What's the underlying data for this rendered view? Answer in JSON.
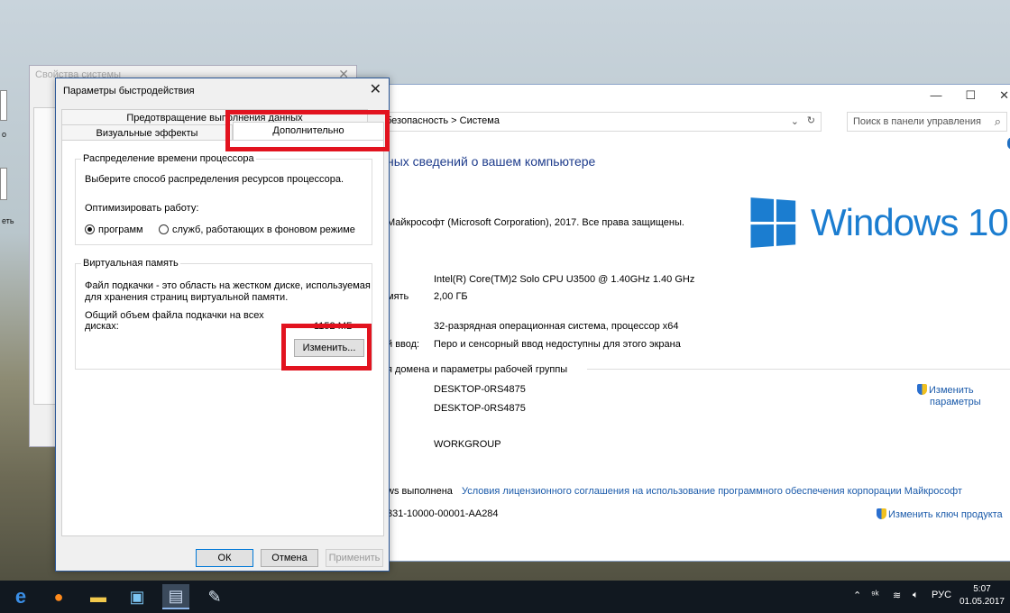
{
  "desktop": {
    "labels": [
      "о",
      "еть"
    ]
  },
  "system_window": {
    "address": "безопасность  >  Система",
    "search_placeholder": "Поиск в панели управления",
    "heading": "ных сведений о вашем компьютере",
    "copyright": "Майкрософт (Microsoft Corporation), 2017. Все права защищены.",
    "logo_text": "Windows 10",
    "processor_value": "Intel(R) Core(TM)2 Solo CPU    U3500  @ 1.40GHz   1.40 GHz",
    "memory_label": "мять",
    "memory_value": "2,00 ГБ",
    "system_type_value": "32-разрядная операционная система, процессор x64",
    "pen_label": "й ввод:",
    "pen_value": "Перо и сенсорный ввод недоступны для этого экрана",
    "domain_heading": "я домена и параметры рабочей группы",
    "domain_colon": ":",
    "computer_name": "DESKTOP-0RS4875",
    "full_name": "DESKTOP-0RS4875",
    "workgroup": "WORKGROUP",
    "change_params_1": "Изменить",
    "change_params_2": "параметры",
    "activation_label": "ws выполнена",
    "license_link": "Условия лицензионного соглашения на использование программного обеспечения корпорации Майкрософт",
    "product_id": "331-10000-00001-AA284",
    "change_key": "Изменить ключ продукта"
  },
  "properties_window": {
    "title": "Свойства системы"
  },
  "perf_dialog": {
    "title": "Параметры быстродействия",
    "tabs": {
      "dep": "Предотвращение выполнения данных",
      "visual": "Визуальные эффекты",
      "advanced": "Дополнительно"
    },
    "cpu_group": {
      "legend": "Распределение времени процессора",
      "description": "Выберите способ распределения ресурсов процессора.",
      "optimize_label": "Оптимизировать работу:",
      "option_programs": "программ",
      "option_services": "служб, работающих в фоновом режиме"
    },
    "vm_group": {
      "legend": "Виртуальная память",
      "desc_line1": "Файл подкачки - это область на жестком диске, используемая",
      "desc_line2": "для хранения страниц виртуальной памяти.",
      "total_line1": "Общий объем файла подкачки на всех",
      "total_line2": "дисках:",
      "total_value": "1152 МБ",
      "change_button": "Изменить..."
    },
    "buttons": {
      "ok": "ОК",
      "cancel": "Отмена",
      "apply": "Применить"
    }
  },
  "taskbar": {
    "tray_lang": "РУС",
    "time": "5:07",
    "date": "01.05.2017"
  },
  "colors": {
    "highlight": "#e2131f",
    "windows_blue": "#1b7dd0",
    "link": "#1a5aaa",
    "taskbar": "#111820"
  }
}
